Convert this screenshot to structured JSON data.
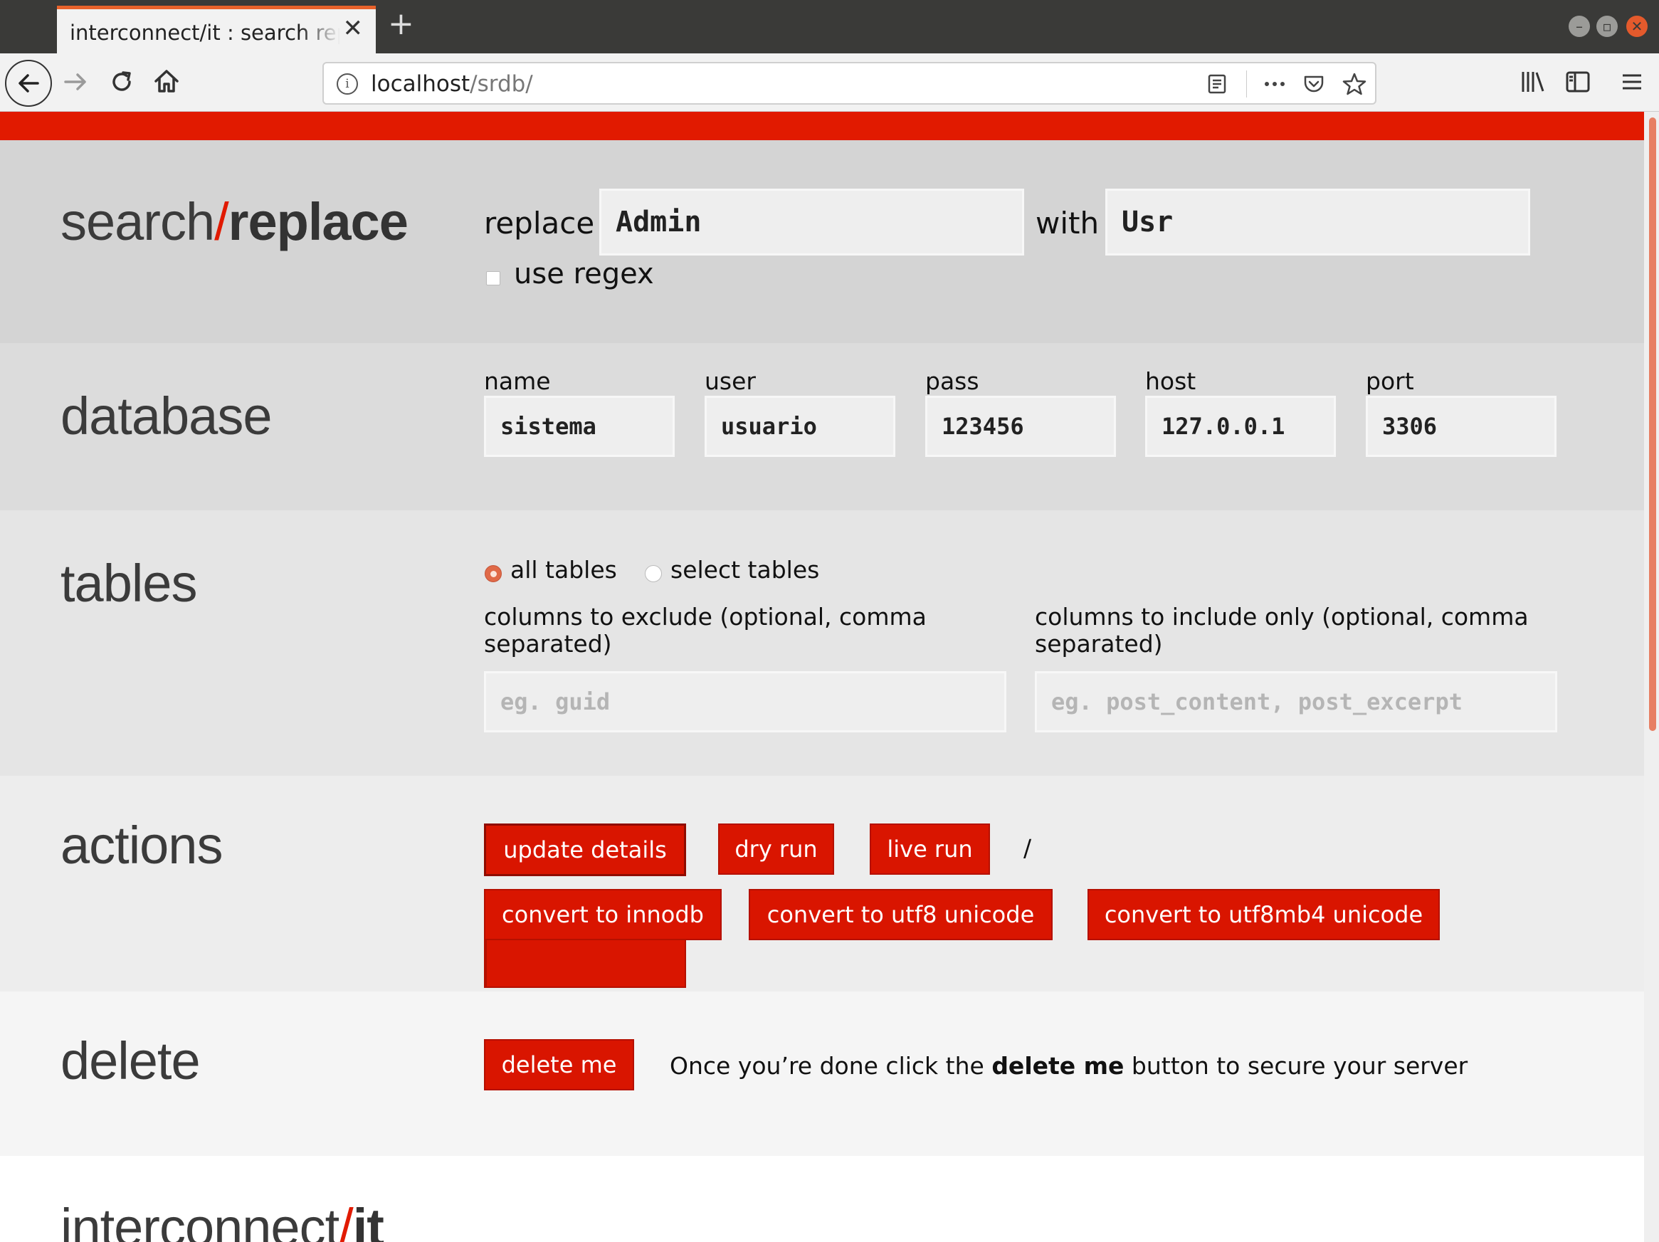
{
  "browser": {
    "tab_title": "interconnect/it : search replace",
    "new_tab_symbol": "+",
    "close_symbol": "✕",
    "url_host": "localhost",
    "url_path": "/srdb/"
  },
  "header": {
    "logo_part1": "search",
    "logo_slash": "/",
    "logo_part2": "replace"
  },
  "search": {
    "replace_label": "replace",
    "replace_value": "Admin",
    "with_label": "with",
    "with_value": "Usr",
    "regex_label": "use regex",
    "regex_checked": false
  },
  "database": {
    "heading": "database",
    "fields": [
      {
        "label": "name",
        "value": "sistema"
      },
      {
        "label": "user",
        "value": "usuario"
      },
      {
        "label": "pass",
        "value": "123456"
      },
      {
        "label": "host",
        "value": "127.0.0.1"
      },
      {
        "label": "port",
        "value": "3306"
      }
    ]
  },
  "tables": {
    "heading": "tables",
    "all_tables_label": "all tables",
    "select_tables_label": "select tables",
    "selected": "all tables",
    "exclude_label_line1": "columns to exclude (optional, comma",
    "exclude_label_line2": "separated)",
    "exclude_placeholder": "eg. guid",
    "include_label_line1": "columns to include only (optional, comma",
    "include_label_line2": "separated)",
    "include_placeholder": "eg. post_content, post_excerpt"
  },
  "actions": {
    "heading": "actions",
    "update_details": "update details",
    "dry_run": "dry run",
    "live_run": "live run",
    "separator": "/",
    "convert_innodb": "convert to innodb",
    "convert_utf8": "convert to utf8 unicode",
    "convert_utf8mb4": "convert to utf8mb4 unicode"
  },
  "delete": {
    "heading": "delete",
    "button": "delete me",
    "message_before": "Once you’re done click the ",
    "message_bold": "delete me",
    "message_after": " button to secure your server"
  },
  "footer": {
    "logo_part1": "interconnect",
    "logo_slash": "/",
    "logo_part2": "it"
  },
  "colors": {
    "accent_red": "#e11a00",
    "button_red": "#d91500",
    "tab_accent": "#e8622b"
  }
}
